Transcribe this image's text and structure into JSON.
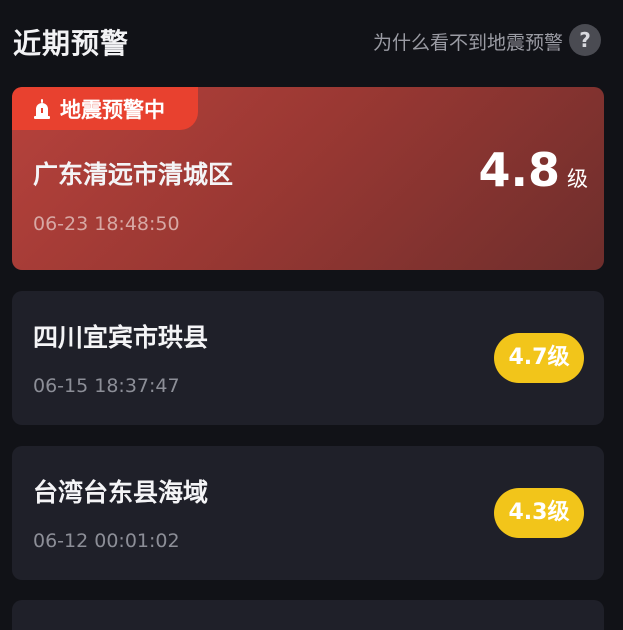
{
  "header": {
    "title": "近期预警",
    "why_link": "为什么看不到地震预警",
    "help_icon_glyph": "?"
  },
  "active_alert": {
    "badge_label": "地震预警中",
    "badge_icon": "alarm-icon",
    "location": "广东清远市清城区",
    "time": "06-23 18:48:50",
    "magnitude": "4.8",
    "unit": "级",
    "colors": {
      "badge": "#e8412f",
      "card_gradient_start": "#b7423c",
      "card_gradient_end": "#6e2e2c"
    }
  },
  "alerts": [
    {
      "location": "四川宜宾市珙县",
      "time": "06-15 18:37:47",
      "magnitude_label": "4.7级"
    },
    {
      "location": "台湾台东县海域",
      "time": "06-12 00:01:02",
      "magnitude_label": "4.3级"
    }
  ],
  "colors": {
    "background": "#111217",
    "card": "#1f2029",
    "magnitude_pill": "#f2c51a"
  }
}
